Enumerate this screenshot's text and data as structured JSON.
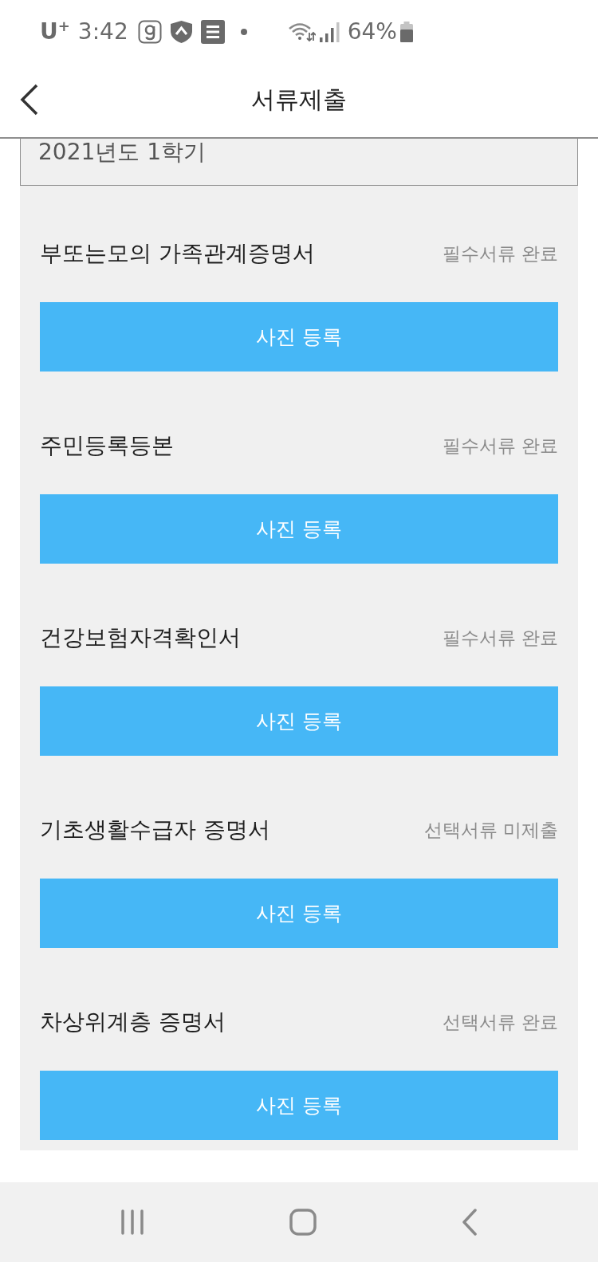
{
  "status_bar": {
    "carrier": "U$^{+}$",
    "time": "3:42",
    "battery": "64%"
  },
  "header": {
    "title": "서류제출"
  },
  "semester": {
    "value": "2021년도 1학기"
  },
  "documents": [
    {
      "name": "부또는모의 가족관계증명서",
      "status": "필수서류 완료",
      "button": "사진 등록"
    },
    {
      "name": "주민등록등본",
      "status": "필수서류 완료",
      "button": "사진 등록"
    },
    {
      "name": "건강보험자격확인서",
      "status": "필수서류 완료",
      "button": "사진 등록"
    },
    {
      "name": "기초생활수급자 증명서",
      "status": "선택서류 미제출",
      "button": "사진 등록"
    },
    {
      "name": "차상위계층 증명서",
      "status": "선택서류 완료",
      "button": "사진 등록"
    }
  ]
}
